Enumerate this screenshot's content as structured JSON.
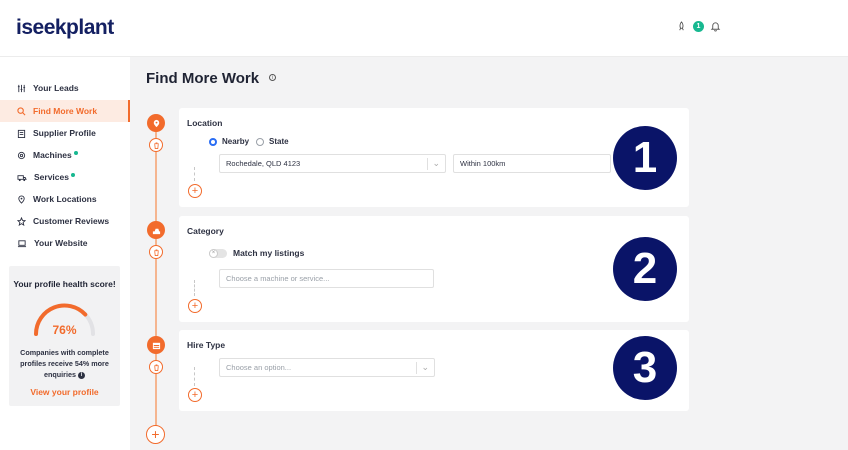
{
  "brand": {
    "name": "iseekplant"
  },
  "topbar": {
    "notification_count": "1"
  },
  "sidebar": {
    "items": [
      {
        "label": "Your Leads",
        "icon": "sliders-icon"
      },
      {
        "label": "Find More Work",
        "icon": "search-icon"
      },
      {
        "label": "Supplier Profile",
        "icon": "clipboard-icon"
      },
      {
        "label": "Machines",
        "icon": "gear-icon"
      },
      {
        "label": "Services",
        "icon": "truck-icon"
      },
      {
        "label": "Work Locations",
        "icon": "map-pin-icon"
      },
      {
        "label": "Customer Reviews",
        "icon": "star-icon"
      },
      {
        "label": "Your Website",
        "icon": "laptop-icon"
      }
    ]
  },
  "health": {
    "title": "Your profile health score!",
    "percent": "76%",
    "percent_value": 0.76,
    "description": "Companies with complete profiles receive 54% more enquiries",
    "link": "View your profile"
  },
  "page": {
    "title": "Find More Work",
    "info": "i"
  },
  "location": {
    "label": "Location",
    "options": [
      "Nearby",
      "State"
    ],
    "selected": "Nearby",
    "location_value": "Rochedale, QLD 4123",
    "radius_value": "Within 100km",
    "step_number": "1"
  },
  "category": {
    "label": "Category",
    "toggle_label": "Match my listings",
    "toggle_mark": "×",
    "placeholder": "Choose a machine or service...",
    "step_number": "2"
  },
  "hire_type": {
    "label": "Hire Type",
    "placeholder": "Choose an option...",
    "step_number": "3"
  },
  "colors": {
    "accent": "#f26b2c",
    "brand": "#142062",
    "badge": "#0a1468",
    "success": "#17b890"
  }
}
